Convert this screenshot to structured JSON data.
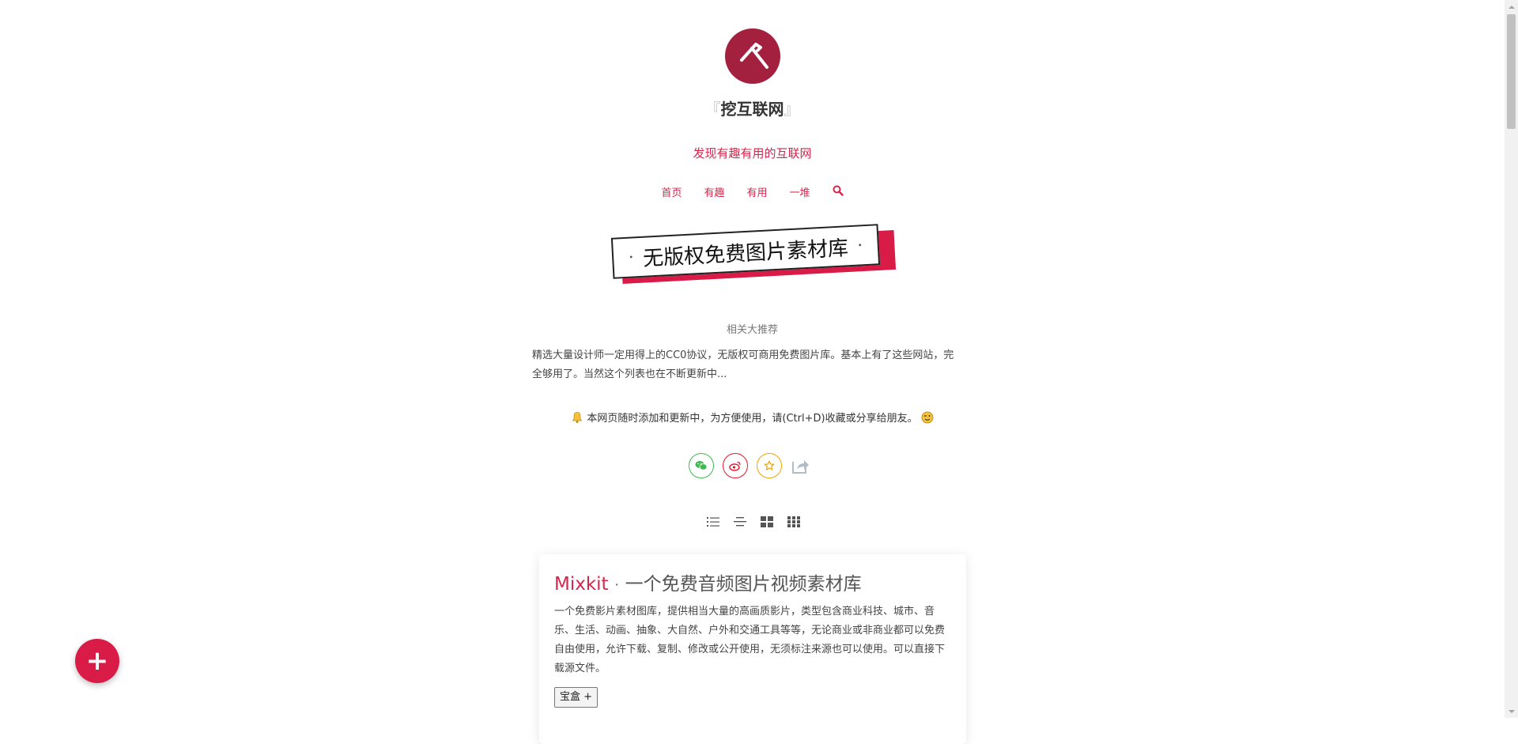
{
  "site": {
    "name": "挖互联网",
    "bracket_open": "『",
    "bracket_close": "』",
    "tagline": "发现有趣有用的互联网"
  },
  "nav": {
    "items": [
      "首页",
      "有趣",
      "有用",
      "一堆"
    ],
    "search_icon": "search-icon"
  },
  "banner": {
    "title": "无版权免费图片素材库"
  },
  "subhead": "相关大推荐",
  "intro": "精选大量设计师一定用得上的CC0协议，无版权可商用免费图片库。基本上有了这些网站，完全够用了。当然这个列表也在不断更新中...",
  "notice": "本网页随时添加和更新中，为方便使用，请(Ctrl+D)收藏或分享给朋友。",
  "share": {
    "icons": [
      "wechat-icon",
      "weibo-icon",
      "star-icon",
      "share-forward-icon"
    ]
  },
  "view_modes": [
    "list-view-icon",
    "center-list-view-icon",
    "grid-large-view-icon",
    "grid-small-view-icon"
  ],
  "card": {
    "name": "Mixkit",
    "separator": "·",
    "subtitle": "一个免费音频图片视频素材库",
    "description": "一个免费影片素材图库，提供相当大量的高画质影片，类型包含商业科技、城市、音乐、生活、动画、抽象、大自然、户外和交通工具等等，无论商业或非商业都可以免费自由使用，允许下载、复制、修改或公开使用，无须标注来源也可以使用。可以直接下载源文件。",
    "button": "宝盒 +"
  },
  "fab": {
    "label": "+"
  },
  "colors": {
    "accent": "#d6264c",
    "logo": "#a3213f",
    "banner": "#d81b47",
    "wechat": "#3eb94e",
    "weibo": "#e6162d",
    "fav": "#f0a400"
  }
}
